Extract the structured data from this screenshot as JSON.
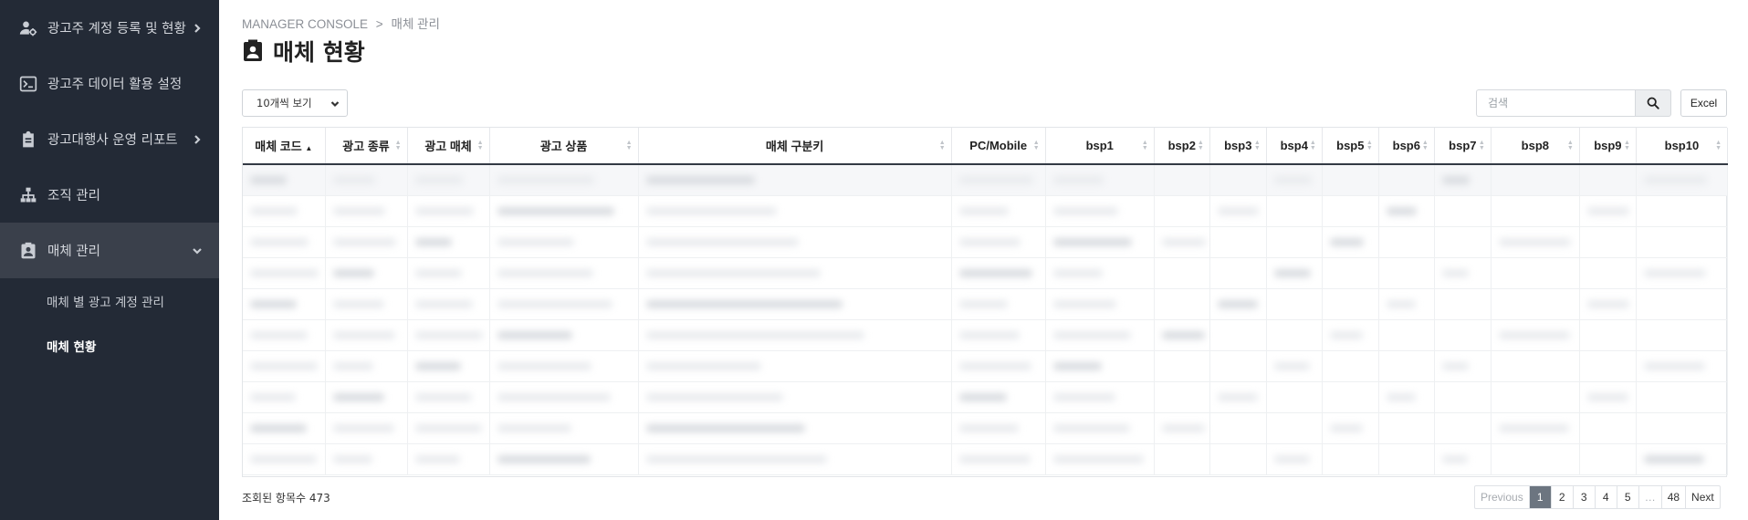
{
  "sidebar": {
    "items": [
      {
        "label": "광고주 계정 등록 및 현황",
        "icon": "user-gear-icon",
        "chevron": "right"
      },
      {
        "label": "광고주 데이터 활용 설정",
        "icon": "terminal-icon",
        "chevron": ""
      },
      {
        "label": "광고대행사 운영 리포트",
        "icon": "clipboard-icon",
        "chevron": "right"
      },
      {
        "label": "조직 관리",
        "icon": "org-chart-icon",
        "chevron": ""
      },
      {
        "label": "매체 관리",
        "icon": "contact-card-icon",
        "chevron": "down"
      }
    ],
    "sub_items": [
      {
        "label": "매체 별 광고 계정 관리"
      },
      {
        "label": "매체 현황"
      }
    ]
  },
  "breadcrumb": {
    "root": "MANAGER CONSOLE",
    "separator": ">",
    "current": "매체 관리"
  },
  "page": {
    "title": "매체 현황"
  },
  "controls": {
    "page_size": "10개씩 보기",
    "search_placeholder": "검색",
    "excel_label": "Excel"
  },
  "table": {
    "headers": [
      "매체 코드",
      "광고 종류",
      "광고 매체",
      "광고 상품",
      "매체 구분키",
      "PC/Mobile",
      "bsp1",
      "bsp2",
      "bsp3",
      "bsp4",
      "bsp5",
      "bsp6",
      "bsp7",
      "bsp8",
      "bsp9",
      "bsp10"
    ],
    "sorted_column": "매체 코드",
    "rows_visible": 10
  },
  "footer": {
    "count_text": "조회된 항목수 473",
    "pagination": {
      "previous": "Previous",
      "pages": [
        "1",
        "2",
        "3",
        "4",
        "5"
      ],
      "ellipsis": "…",
      "last": "48",
      "next": "Next",
      "current": "1"
    }
  },
  "colors": {
    "sidebar_bg": "#232a36",
    "sidebar_active": "#3a404b",
    "pager_active": "#6c7580"
  }
}
